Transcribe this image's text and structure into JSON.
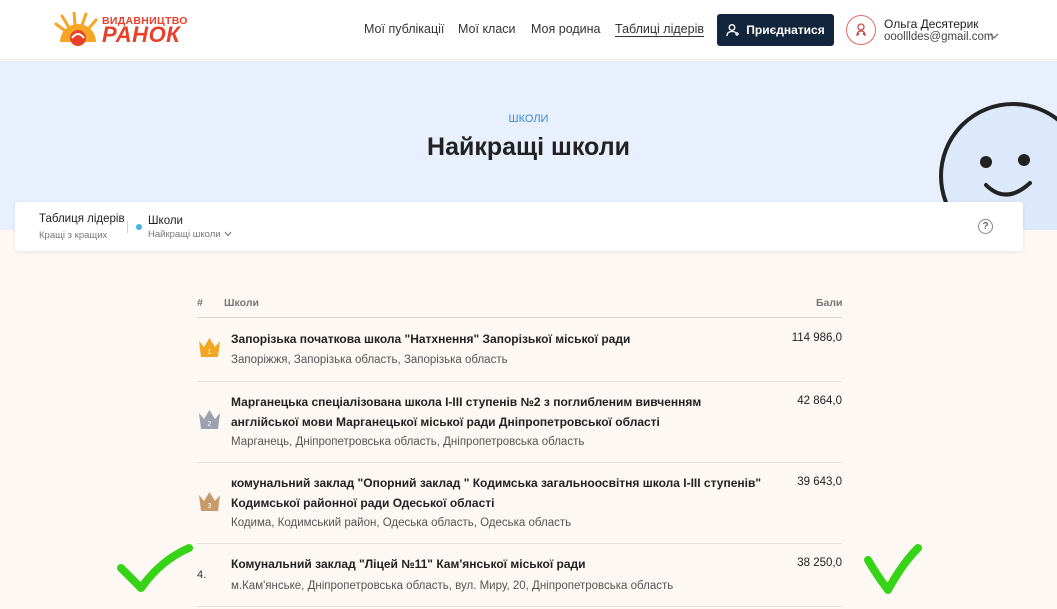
{
  "header": {
    "logo": {
      "top": "ВИДАВНИЦТВО",
      "main": "РАНОК"
    },
    "nav": [
      {
        "label": "Мої публікації"
      },
      {
        "label": "Мої класи"
      },
      {
        "label": "Моя родина"
      },
      {
        "label": "Таблиці лідерів",
        "active": true
      }
    ],
    "join_label": "Приєднатися",
    "user": {
      "name": "Ольга Десятерик",
      "email": "ooollldes@gmail.com"
    }
  },
  "hero": {
    "category": "ШКОЛИ",
    "title": "Найкращі школи"
  },
  "filter": {
    "board_title": "Таблиця лідерів",
    "board_subtitle": "Кращі з кращих",
    "section_title": "Школи",
    "section_subtitle": "Найкращі школи",
    "help": "?"
  },
  "table": {
    "columns": {
      "rank": "#",
      "school": "Школи",
      "score": "Бали"
    },
    "rows": [
      {
        "rank": "1",
        "medal": "gold",
        "name": "Запорізька початкова школа \"Натхнення\" Запорізької міської ради",
        "address": "Запоріжжя, Запорізька область, Запорізька область",
        "score": "114 986,0"
      },
      {
        "rank": "2",
        "medal": "silver",
        "name": "Марганецька спеціалізована школа І-ІІІ ступенів №2 з поглибленим вивченням англійської мови Марганецької міської ради Дніпропетровської області",
        "address": "Марганець, Дніпропетровська область, Дніпропетровська область",
        "score": "42 864,0"
      },
      {
        "rank": "3",
        "medal": "bronze",
        "name": "комунальний заклад \"Опорний заклад \" Кодимська загальноосвітня школа І-ІІІ ступенів\" Кодимської районної ради Одеської області",
        "address": "Кодима, Кодимський район, Одеська область, Одеська область",
        "score": "39 643,0"
      },
      {
        "rank": "4.",
        "name": "Комунальний заклад \"Ліцей №11\" Кам'янської міської ради",
        "address": "м.Кам'янське, Дніпропетровська область, вул. Миру, 20, Дніпропетровська область",
        "score": "38 250,0"
      }
    ]
  },
  "colors": {
    "brand": "#e8402a",
    "gold": "#f3a623",
    "silver": "#9aa3ad",
    "bronze": "#c79a6a",
    "check": "#36d417",
    "button": "#13253d"
  }
}
